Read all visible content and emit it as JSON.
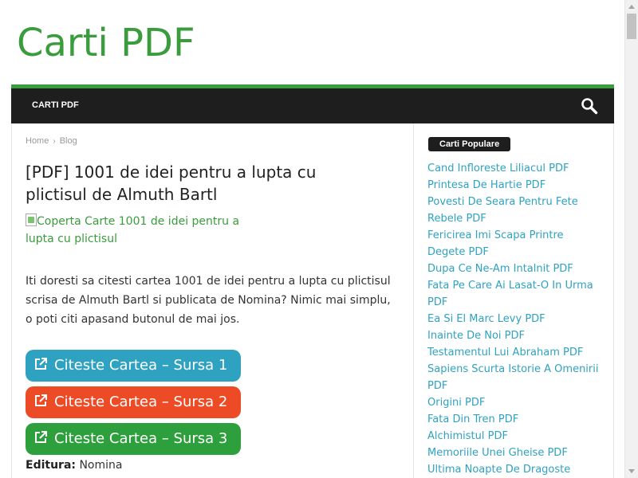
{
  "site": {
    "logo": "Carti PDF"
  },
  "nav": {
    "items": [
      {
        "label": "CARTI PDF"
      }
    ]
  },
  "breadcrumb": {
    "home": "Home",
    "separator": "›",
    "current": "Blog"
  },
  "post": {
    "title": "[PDF] 1001 de idei pentru a lupta cu plictisul de Almuth Bartl",
    "cover_alt": "Coperta Carte 1001 de idei pentru a lupta cu plictisul",
    "intro": "Iti doresti sa citesti cartea 1001 de idei pentru a lupta cu plictisul scrisa de Almuth Bartl si publicata de Nomina? Nimic mai simplu, o poti citi apasand butonul de mai jos.",
    "buttons": [
      {
        "label": "Citeste Cartea – Sursa 1",
        "color": "#2fa2c1"
      },
      {
        "label": "Citeste Cartea – Sursa 2",
        "color": "#ec4b25"
      },
      {
        "label": "Citeste Cartea – Sursa 3",
        "color": "#2e9f3d"
      }
    ],
    "meta": {
      "publisher_label": "Editura:",
      "publisher_value": "Nomina"
    }
  },
  "sidebar": {
    "widget_title": "Carti Populare",
    "items": [
      "Cand Infloreste Liliacul PDF",
      "Printesa De Hartie PDF",
      "Povesti De Seara Pentru Fete Rebele PDF",
      "Fericirea Imi Scapa Printre Degete PDF",
      "Dupa Ce Ne-Am Intalnit PDF",
      "Fata Pe Care Ai Lasat-O In Urma PDF",
      "Ea Si El Marc Levy PDF",
      "Inainte De Noi PDF",
      "Testamentul Lui Abraham PDF",
      "Sapiens Scurta Istorie A Omenirii PDF",
      "Origini PDF",
      "Fata Din Tren PDF",
      "Alchimistul PDF",
      "Memoriile Unei Gheise PDF",
      "Ultima Noapte De Dragoste"
    ]
  },
  "colors": {
    "brand": "#3a9c3d",
    "nav_bg": "#1e1e1e",
    "link": "#2fa2c1"
  },
  "icons": {
    "search": "search-icon",
    "external": "external-link-icon",
    "broken_image": "broken-image-icon"
  }
}
